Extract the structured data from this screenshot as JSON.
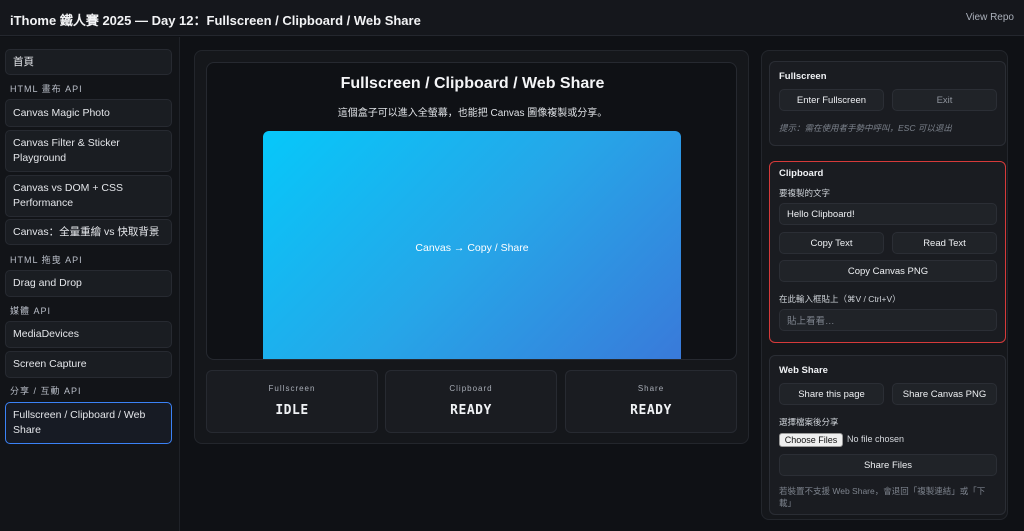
{
  "header": {
    "title": "iThome 鐵人賽 2025 — Day 12：Fullscreen / Clipboard / Web Share",
    "repo_link": "View Repo"
  },
  "sidebar": {
    "home": "首頁",
    "section_canvas": "HTML 畫布 API",
    "item_magic_photo": "Canvas Magic Photo",
    "item_filter_sticker": "Canvas Filter & Sticker Playground",
    "item_canvas_dom": "Canvas vs DOM + CSS Performance",
    "item_redraw": "Canvas：全量重繪 vs 快取背景",
    "section_drag": "HTML 拖曳 API",
    "item_drag_drop": "Drag and Drop",
    "section_media": "媒體 API",
    "item_media_devices": "MediaDevices",
    "item_screen_capture": "Screen Capture",
    "section_share": "分享 / 互動 API",
    "item_fullscreen": "Fullscreen / Clipboard / Web Share"
  },
  "stage": {
    "title": "Fullscreen / Clipboard / Web Share",
    "description": "這個盒子可以進入全螢幕，也能把 Canvas 圖像複製或分享。",
    "canvas_text": "Canvas → Copy / Share"
  },
  "status": [
    {
      "label": "Fullscreen",
      "value": "IDLE"
    },
    {
      "label": "Clipboard",
      "value": "READY"
    },
    {
      "label": "Share",
      "value": "READY"
    }
  ],
  "fullscreen": {
    "title": "Fullscreen",
    "enter_button": "Enter Fullscreen",
    "exit_button": "Exit",
    "hint": "提示：需在使用者手勢中呼叫，ESC 可以退出"
  },
  "clipboard": {
    "title": "Clipboard",
    "copy_label": "要複製的文字",
    "copy_value": "Hello Clipboard!",
    "copy_text_button": "Copy Text",
    "read_text_button": "Read Text",
    "copy_png_button": "Copy Canvas PNG",
    "paste_label": "在此輸入框貼上（⌘V / Ctrl+V）",
    "paste_placeholder": "貼上看看…"
  },
  "webshare": {
    "title": "Web Share",
    "share_page_button": "Share this page",
    "share_png_button": "Share Canvas PNG",
    "file_label": "選擇檔案後分享",
    "choose_files_button": "Choose Files",
    "file_status": "No file chosen",
    "share_files_button": "Share Files",
    "fallback_note": "若裝置不支援 Web Share，會退回「複製連結」或「下載」"
  },
  "colors": {
    "accent": "#3b82f6",
    "highlight_border": "#d63a3a",
    "canvas_gradient_start": "#06c8fa",
    "canvas_gradient_end": "#3a78d9"
  }
}
